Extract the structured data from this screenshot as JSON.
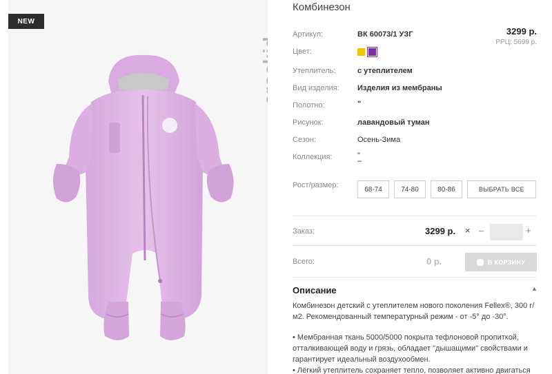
{
  "gallery": {
    "badge": "NEW",
    "brand": "crockid"
  },
  "product": {
    "title": "Комбинезон",
    "price": "3299 р.",
    "rrp": "РРЦ: 5699 р."
  },
  "properties": {
    "article": {
      "label": "Артикул:",
      "value": "ВК 60073/1 УЗГ"
    },
    "color": {
      "label": "Цвет:"
    },
    "insulation": {
      "label": "Утеплитель:",
      "value": "с утеплителем"
    },
    "item_type": {
      "label": "Вид изделия:",
      "value": "Изделия из мембраны"
    },
    "fabric": {
      "label": "Полотно:",
      "value": "\""
    },
    "pattern": {
      "label": "Рисунок:",
      "value": "лавандовый туман"
    },
    "season": {
      "label": "Сезон:",
      "value": "Осень-Зима"
    },
    "collection": {
      "label": "Коллекция:",
      "value": "\"",
      "value2": "–"
    }
  },
  "colors": [
    "#f2c500",
    "#7a2fa0"
  ],
  "sizes": {
    "label": "Рост/размер:",
    "options": [
      "68-74",
      "74-80",
      "80-86"
    ],
    "select_all": "ВЫБРАТЬ ВСЕ"
  },
  "order": {
    "label": "Заказ:",
    "price": "3299 р.",
    "times": "×",
    "minus": "–",
    "plus": "+",
    "qty": ""
  },
  "total": {
    "label": "Всего:",
    "value": "0 р.",
    "cart_button": "В КОРЗИНУ"
  },
  "description": {
    "title": "Описание",
    "caret": "▲",
    "para1": "Комбинезон детский с утеплителем нового поколения Fellex®, 300 г/м2. Рекомендованный температурный режим - от -5° до -30°.",
    "bullet1": "• Мембранная ткань 5000/5000 покрыта тефлоновой пропиткой, отталкивающей воду и грязь, обладает \"дышащими\" свойствами и гарантирует идеальный воздухообмен.",
    "bullet2": "• Лёгкий утеплитель сохраняет тепло, позволяет активно двигаться"
  }
}
